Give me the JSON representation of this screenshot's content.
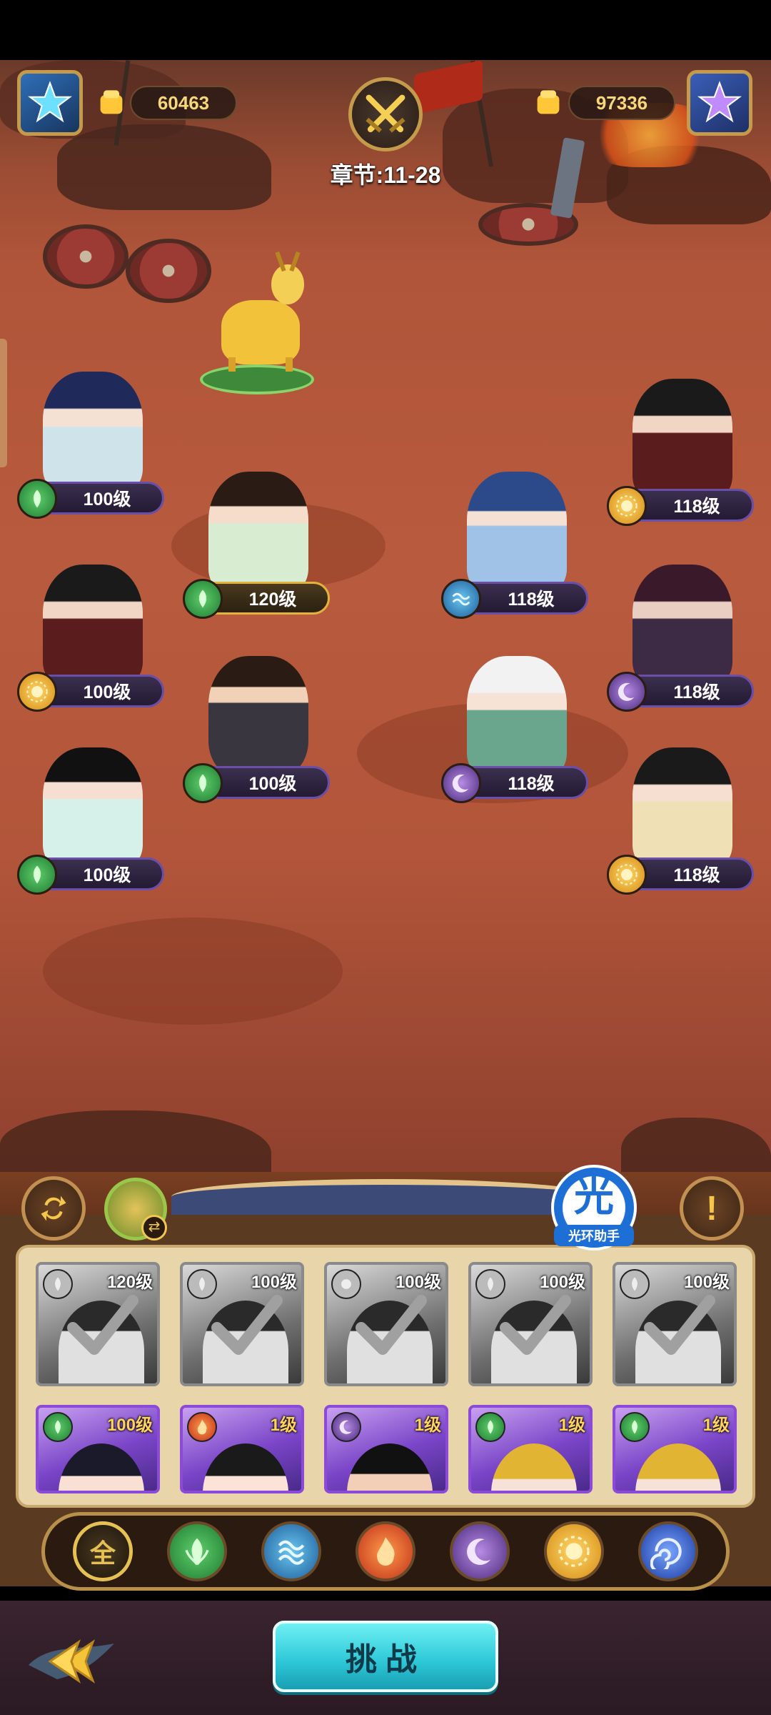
{
  "header": {
    "left_power": "60463",
    "right_power": "97336",
    "chapter": "章节:11-28",
    "colors": {
      "gold": "#f7d77b",
      "frame": "#c59a4a"
    }
  },
  "icons": {
    "left_gem": "blue-star-gem-icon",
    "right_gem": "purple-star-gem-icon",
    "battle": "crossed-swords-icon"
  },
  "pet": {
    "name": "golden-deer"
  },
  "left_team": [
    {
      "level": "100级",
      "element": "wood"
    },
    {
      "level": "120级",
      "element": "wood"
    },
    {
      "level": "100级",
      "element": "sun"
    },
    {
      "level": "100级",
      "element": "wood"
    },
    {
      "level": "100级",
      "element": "wood"
    }
  ],
  "right_team": [
    {
      "level": "118级",
      "element": "sun"
    },
    {
      "level": "118级",
      "element": "water"
    },
    {
      "level": "118级",
      "element": "moon"
    },
    {
      "level": "118级",
      "element": "moon"
    },
    {
      "level": "118级",
      "element": "sun"
    }
  ],
  "halo": {
    "glyph": "光",
    "label": "光环助手"
  },
  "hint_button": "!",
  "cards_row1": [
    {
      "level": "120级",
      "selected": true
    },
    {
      "level": "100级",
      "selected": true
    },
    {
      "level": "100级",
      "selected": true
    },
    {
      "level": "100级",
      "selected": true
    },
    {
      "level": "100级",
      "selected": true
    }
  ],
  "cards_row2": [
    {
      "level": "100级",
      "element": "wood"
    },
    {
      "level": "1级",
      "element": "fire"
    },
    {
      "level": "1级",
      "element": "moon"
    },
    {
      "level": "1级",
      "element": "wood"
    },
    {
      "level": "1级",
      "element": "wood"
    }
  ],
  "filters": {
    "all_label": "全",
    "items": [
      "wood",
      "water",
      "fire",
      "moon",
      "sun",
      "vortex"
    ]
  },
  "challenge": "挑战"
}
